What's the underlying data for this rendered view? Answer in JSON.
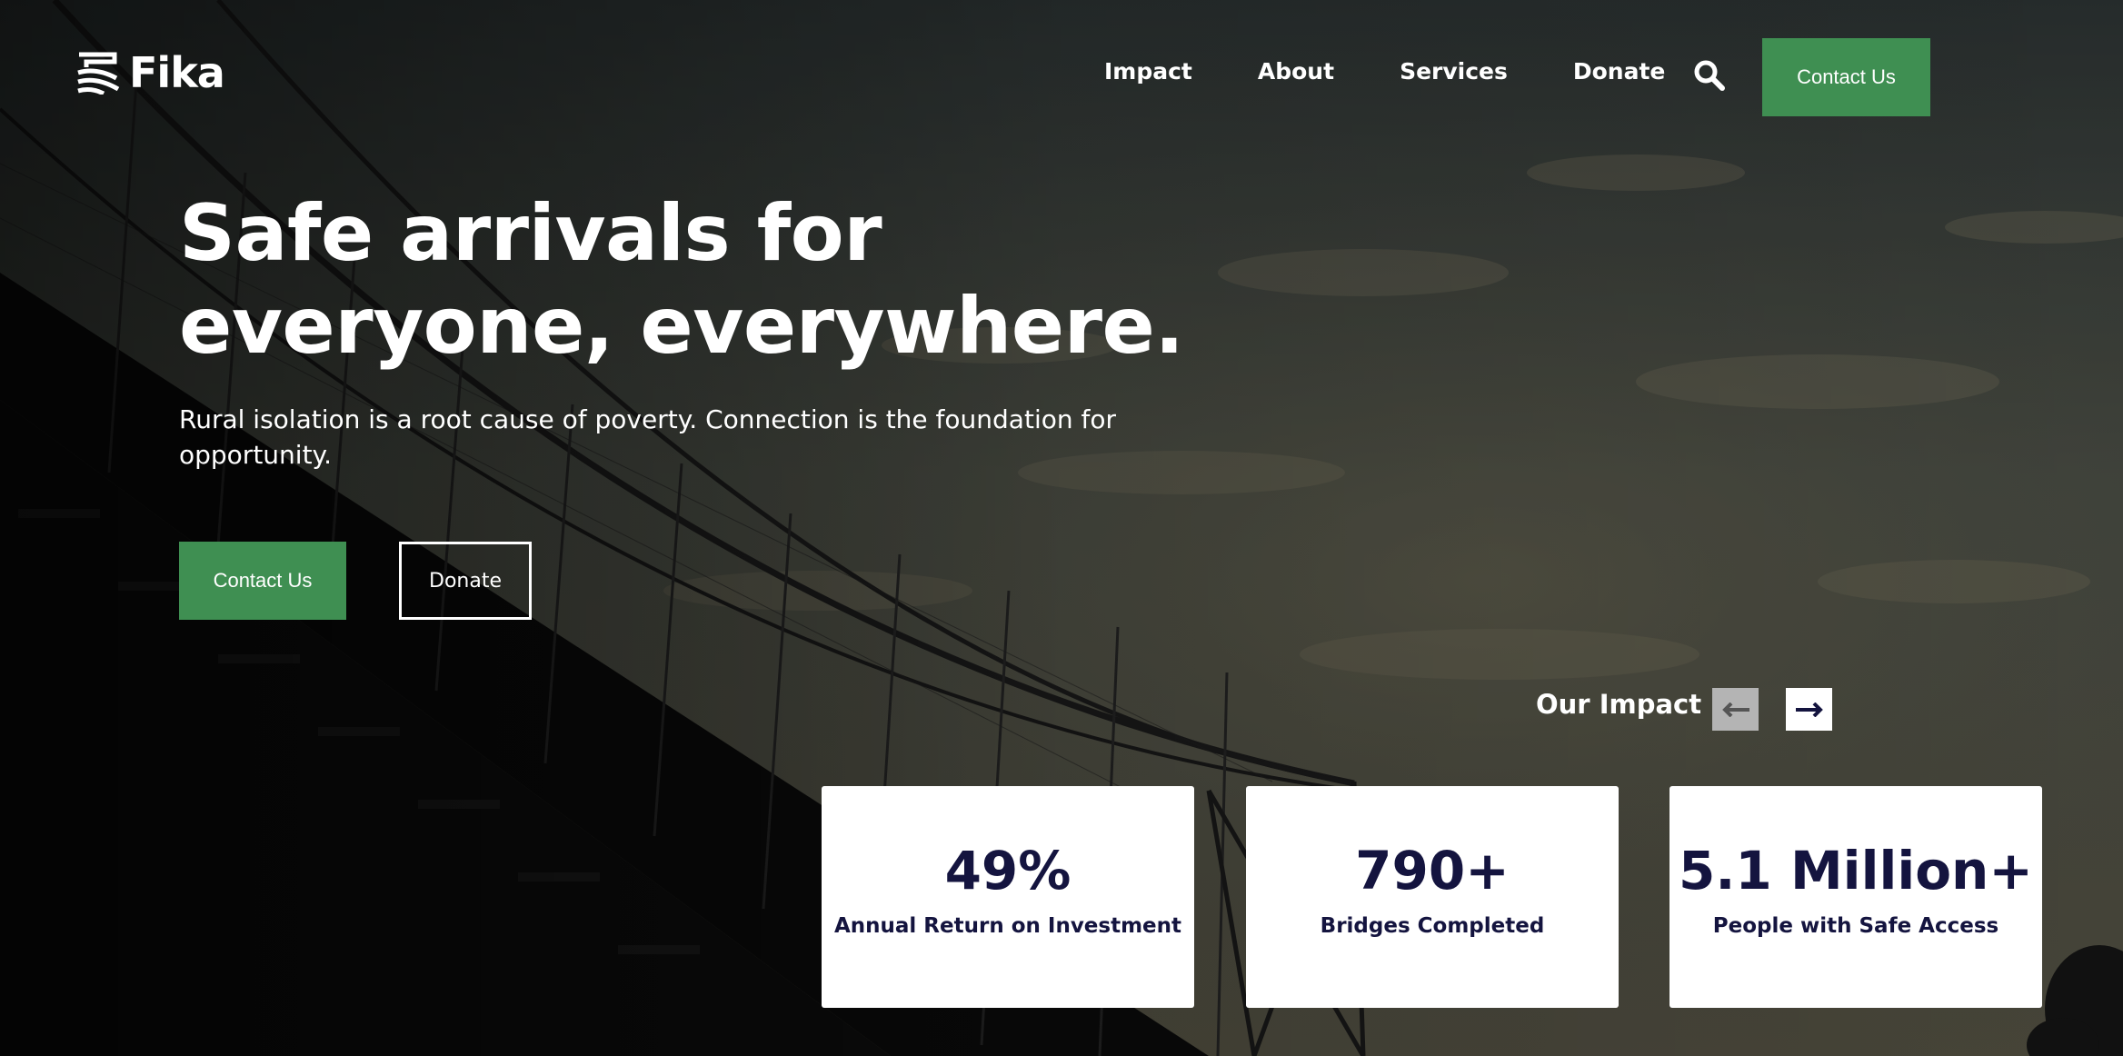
{
  "brand": {
    "name": "Fika",
    "accent_color": "#3f8f52",
    "dark_text_color": "#14143f"
  },
  "nav": {
    "items": [
      {
        "label": "Impact"
      },
      {
        "label": "About"
      },
      {
        "label": "Services"
      },
      {
        "label": "Donate"
      }
    ],
    "search_icon": "search-icon",
    "contact_label": "Contact Us"
  },
  "hero": {
    "title": "Safe arrivals for everyone, everywhere.",
    "subtitle": "Rural isolation is a root cause of poverty. Connection is the foundation for opportunity.",
    "primary_button": "Contact Us",
    "secondary_button": "Donate",
    "background": "suspension bridge at dusk"
  },
  "impact": {
    "heading": "Our Impact",
    "prev_icon": "arrow-left-icon",
    "next_icon": "arrow-right-icon",
    "stats": [
      {
        "value": "49%",
        "label": "Annual Return on Investment"
      },
      {
        "value": "790+",
        "label": "Bridges Completed"
      },
      {
        "value": "5.1 Million+",
        "label": "People with Safe Access"
      }
    ]
  }
}
